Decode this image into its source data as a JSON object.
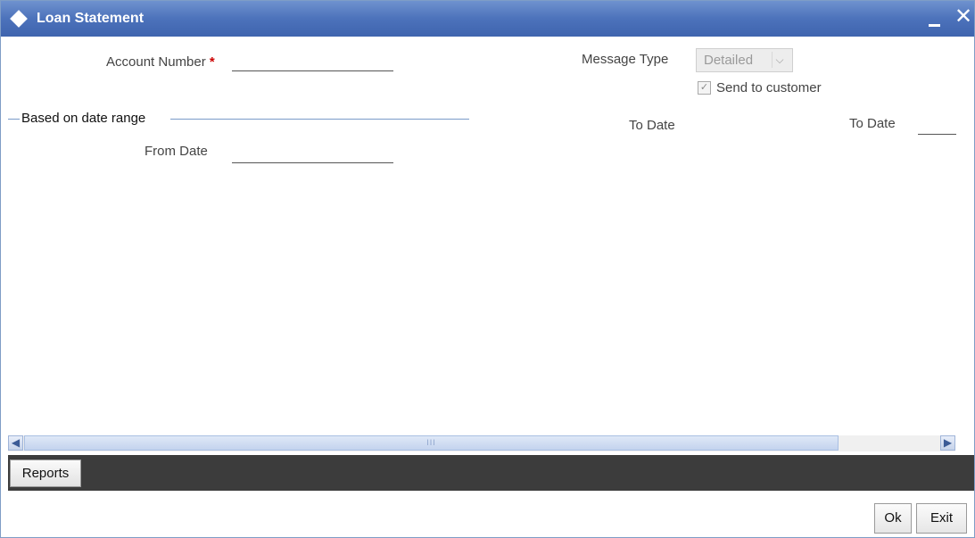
{
  "window": {
    "title": "Loan Statement"
  },
  "form": {
    "account_number": {
      "label": "Account Number",
      "required_mark": "*",
      "value": ""
    },
    "message_type": {
      "label": "Message Type",
      "selected": "Detailed"
    },
    "send_to_customer": {
      "label": "Send to customer",
      "checked": true
    },
    "date_range": {
      "legend": "Based on date range",
      "from_date": {
        "label": "From Date",
        "value": ""
      },
      "to_date_1": {
        "label": "To Date"
      },
      "to_date_2": {
        "label": "To Date",
        "value": ""
      }
    }
  },
  "scrollbar": {
    "grip": "III"
  },
  "tabs": [
    {
      "label": "Reports"
    }
  ],
  "buttons": {
    "ok": "Ok",
    "exit": "Exit"
  },
  "colors": {
    "titlebar": "#4c72bb",
    "required": "#cc0000",
    "tabbar": "#3c3c3c"
  }
}
